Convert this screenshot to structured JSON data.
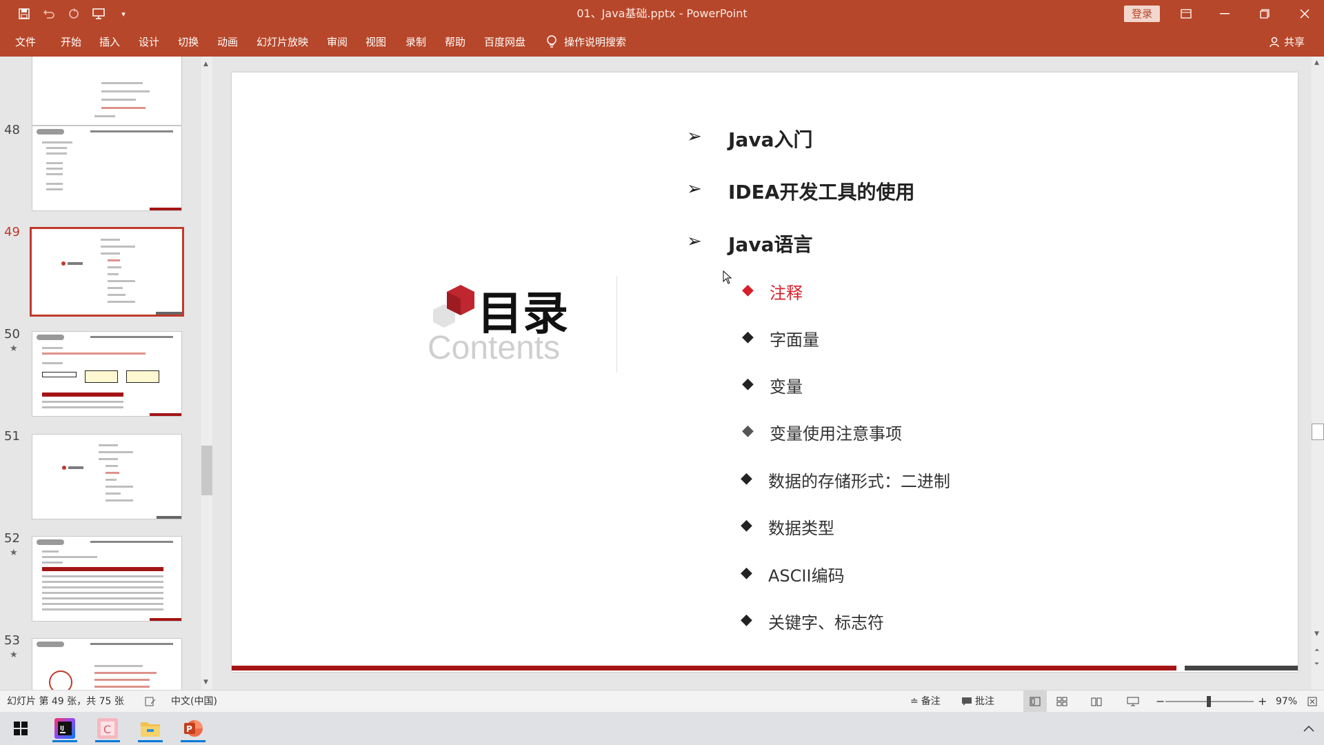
{
  "window": {
    "title": "01、Java基础.pptx  -  PowerPoint",
    "login_label": "登录"
  },
  "ribbon": {
    "tabs": [
      "文件",
      "开始",
      "插入",
      "设计",
      "切换",
      "动画",
      "幻灯片放映",
      "审阅",
      "视图",
      "录制",
      "帮助",
      "百度网盘"
    ],
    "search_label": "操作说明搜索",
    "share_label": "共享"
  },
  "thumbnails": [
    {
      "number": "",
      "starred": false
    },
    {
      "number": "48",
      "starred": false
    },
    {
      "number": "49",
      "starred": false,
      "active": true
    },
    {
      "number": "50",
      "starred": true
    },
    {
      "number": "51",
      "starred": false
    },
    {
      "number": "52",
      "starred": true
    },
    {
      "number": "53",
      "starred": true
    }
  ],
  "slide": {
    "heading": "目录",
    "subheading": "Contents",
    "sections": [
      {
        "label": "Java入门"
      },
      {
        "label": "IDEA开发工具的使用"
      },
      {
        "label": "Java语言"
      }
    ],
    "topics": [
      {
        "label": "注释",
        "highlighted": true
      },
      {
        "label": "字面量"
      },
      {
        "label": "变量"
      },
      {
        "label": "变量使用注意事项"
      },
      {
        "label": "数据的存储形式：二进制"
      },
      {
        "label": "数据类型"
      },
      {
        "label": "ASCII编码"
      },
      {
        "label": "关键字、标志符"
      }
    ]
  },
  "statusbar": {
    "slide_info": "幻灯片 第 49 张，共 75 张",
    "language": "中文(中国)",
    "notes_label": "备注",
    "comments_label": "批注",
    "zoom": "97%"
  },
  "colors": {
    "accent": "#b7472a",
    "highlight": "#d8202a"
  }
}
